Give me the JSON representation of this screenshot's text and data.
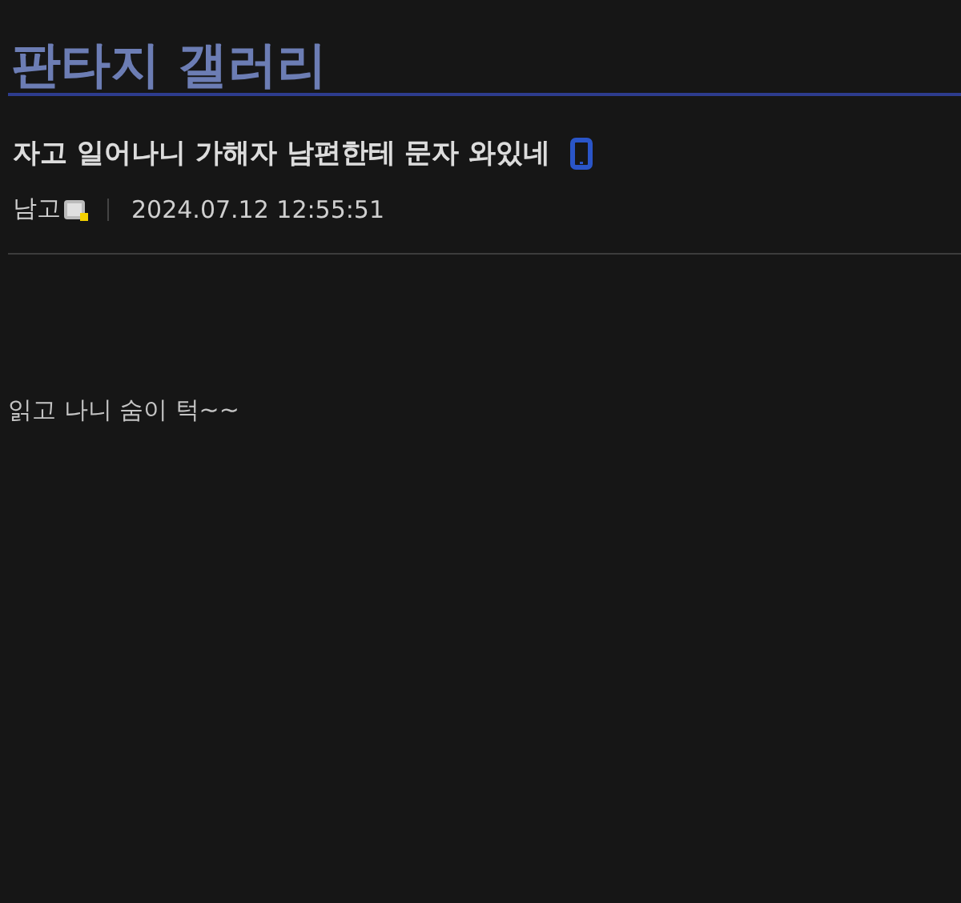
{
  "gallery": {
    "title": "판타지 갤러리"
  },
  "post": {
    "title": "자고 일어나니 가해자 남편한테 문자 와있네",
    "mobile": true,
    "author": "남고",
    "author_badge": true,
    "date": "2024.07.12 12:55:51",
    "body": "읽고 나니 숨이 턱~~"
  }
}
